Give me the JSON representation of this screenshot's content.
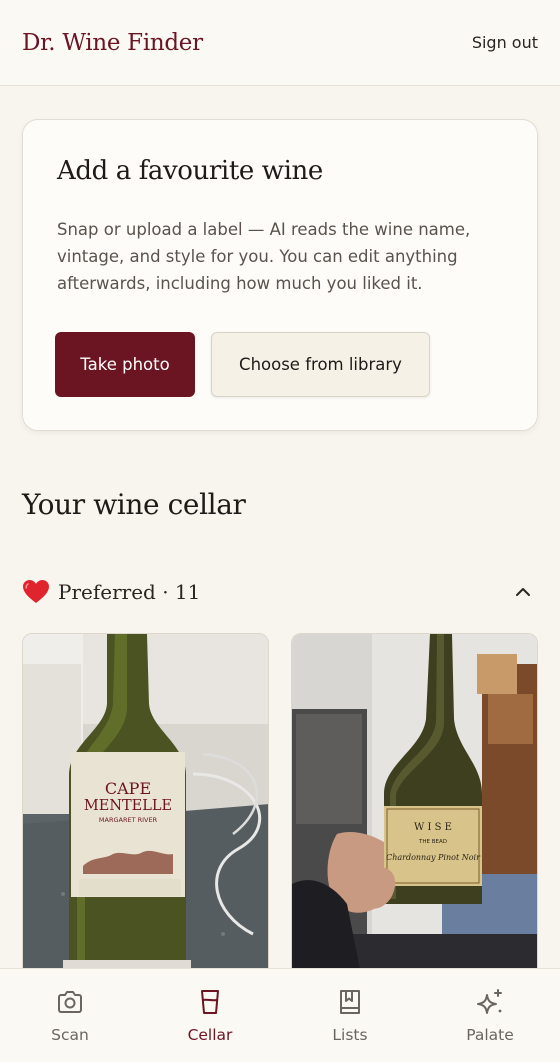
{
  "header": {
    "brand": "Dr. Wine Finder",
    "signout_label": "Sign out"
  },
  "add_card": {
    "title": "Add a favourite wine",
    "description": "Snap or upload a label — AI reads the wine name, vintage, and style for you. You can edit anything afterwards, including how much you liked it.",
    "take_photo_label": "Take photo",
    "library_label": "Choose from library"
  },
  "cellar": {
    "title": "Your wine cellar",
    "section": {
      "icon": "heart-icon",
      "label": "Preferred · 11",
      "expanded": true
    },
    "wines": [
      {
        "label_line1": "CAPE",
        "label_line2": "MENTELLE",
        "label_line3": "MARGARET RIVER"
      },
      {
        "label_line1": "W I S E",
        "label_line2": "THE BEAD",
        "label_line3": "Chardonnay Pinot Noir"
      }
    ]
  },
  "nav": {
    "items": [
      {
        "label": "Scan",
        "icon": "camera-icon",
        "active": false
      },
      {
        "label": "Cellar",
        "icon": "glass-icon",
        "active": true
      },
      {
        "label": "Lists",
        "icon": "bookmark-book-icon",
        "active": false
      },
      {
        "label": "Palate",
        "icon": "sparkle-icon",
        "active": false
      }
    ]
  },
  "colors": {
    "accent": "#6b1422",
    "background": "#f8f5ee",
    "card": "#fdfcf9"
  }
}
